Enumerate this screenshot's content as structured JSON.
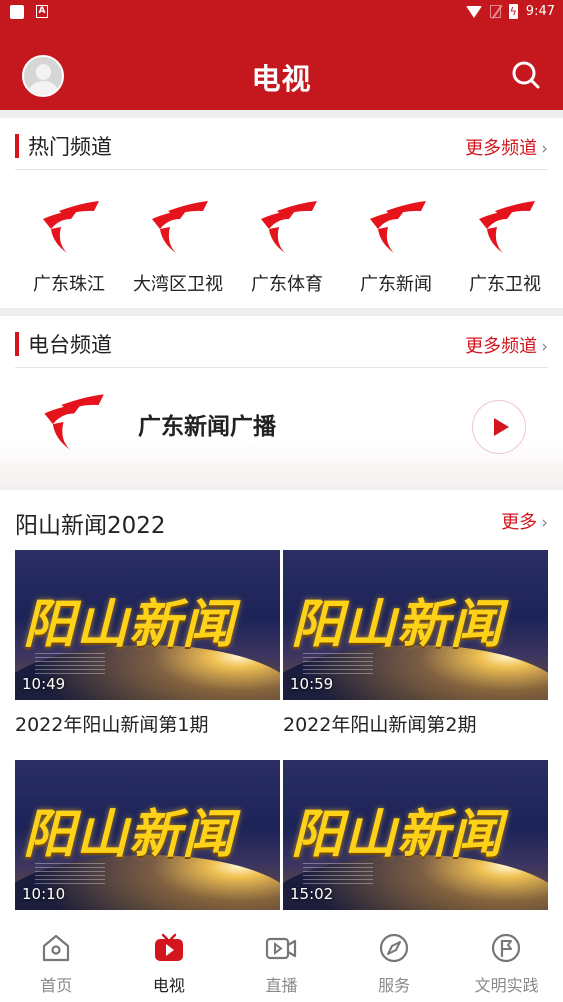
{
  "status_bar": {
    "time": "9:47"
  },
  "header": {
    "title": "电视"
  },
  "hot_channels": {
    "title": "热门频道",
    "more": "更多频道",
    "items": [
      {
        "label": "广东珠江"
      },
      {
        "label": "大湾区卫视"
      },
      {
        "label": "广东体育"
      },
      {
        "label": "广东新闻"
      },
      {
        "label": "广东卫视"
      }
    ]
  },
  "radio_channels": {
    "title": "电台频道",
    "more": "更多频道",
    "item": {
      "label": "广东新闻广播"
    }
  },
  "news": {
    "title": "阳山新闻2022",
    "more": "更多",
    "thumb_text": "阳山新闻",
    "videos": [
      {
        "duration": "10:49",
        "title": "2022年阳山新闻第1期"
      },
      {
        "duration": "10:59",
        "title": "2022年阳山新闻第2期"
      },
      {
        "duration": "10:10",
        "title": ""
      },
      {
        "duration": "15:02",
        "title": ""
      }
    ]
  },
  "bottom_nav": [
    {
      "label": "首页",
      "icon": "home-icon"
    },
    {
      "label": "电视",
      "icon": "tv-icon",
      "active": true
    },
    {
      "label": "直播",
      "icon": "live-video-icon"
    },
    {
      "label": "服务",
      "icon": "compass-icon"
    },
    {
      "label": "文明实践",
      "icon": "flag-circle-icon"
    }
  ],
  "colors": {
    "brand_red": "#c4181e",
    "accent_red": "#d3151d"
  }
}
